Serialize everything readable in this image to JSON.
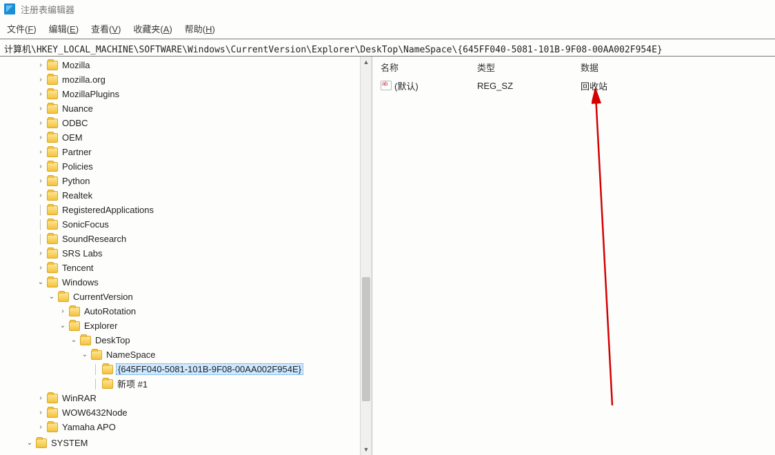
{
  "window": {
    "title": "注册表编辑器"
  },
  "menu": {
    "file": {
      "label": "文件",
      "accel": "F"
    },
    "edit": {
      "label": "编辑",
      "accel": "E"
    },
    "view": {
      "label": "查看",
      "accel": "V"
    },
    "fav": {
      "label": "收藏夹",
      "accel": "A"
    },
    "help": {
      "label": "帮助",
      "accel": "H"
    }
  },
  "addressbar": {
    "path": "计算机\\HKEY_LOCAL_MACHINE\\SOFTWARE\\Windows\\CurrentVersion\\Explorer\\DeskTop\\NameSpace\\{645FF040-5081-101B-9F08-00AA002F954E}"
  },
  "tree": {
    "items": [
      {
        "depth": 3,
        "expander": ">",
        "label": "Mozilla"
      },
      {
        "depth": 3,
        "expander": ">",
        "label": "mozilla.org"
      },
      {
        "depth": 3,
        "expander": ">",
        "label": "MozillaPlugins"
      },
      {
        "depth": 3,
        "expander": ">",
        "label": "Nuance"
      },
      {
        "depth": 3,
        "expander": ">",
        "label": "ODBC"
      },
      {
        "depth": 3,
        "expander": ">",
        "label": "OEM"
      },
      {
        "depth": 3,
        "expander": ">",
        "label": "Partner"
      },
      {
        "depth": 3,
        "expander": ">",
        "label": "Policies"
      },
      {
        "depth": 3,
        "expander": ">",
        "label": "Python"
      },
      {
        "depth": 3,
        "expander": ">",
        "label": "Realtek"
      },
      {
        "depth": 3,
        "expander": "",
        "label": "RegisteredApplications",
        "leaf": true
      },
      {
        "depth": 3,
        "expander": "",
        "label": "SonicFocus",
        "leaf": true
      },
      {
        "depth": 3,
        "expander": "",
        "label": "SoundResearch",
        "leaf": true
      },
      {
        "depth": 3,
        "expander": ">",
        "label": "SRS Labs"
      },
      {
        "depth": 3,
        "expander": ">",
        "label": "Tencent"
      },
      {
        "depth": 3,
        "expander": "v",
        "label": "Windows"
      },
      {
        "depth": 4,
        "expander": "v",
        "label": "CurrentVersion"
      },
      {
        "depth": 5,
        "expander": ">",
        "label": "AutoRotation"
      },
      {
        "depth": 5,
        "expander": "v",
        "label": "Explorer"
      },
      {
        "depth": 6,
        "expander": "v",
        "label": "DeskTop"
      },
      {
        "depth": 7,
        "expander": "v",
        "label": "NameSpace"
      },
      {
        "depth": 8,
        "expander": "",
        "label": "{645FF040-5081-101B-9F08-00AA002F954E}",
        "selected": true,
        "leaf": true
      },
      {
        "depth": 8,
        "expander": "",
        "label": "新项 #1",
        "leaf": true
      },
      {
        "depth": 3,
        "expander": ">",
        "label": "WinRAR"
      },
      {
        "depth": 3,
        "expander": ">",
        "label": "WOW6432Node"
      },
      {
        "depth": 3,
        "expander": ">",
        "label": "Yamaha APO"
      },
      {
        "depth": 2,
        "expander": "v",
        "label": "SYSTEM",
        "cutoff": true
      }
    ]
  },
  "values": {
    "headers": {
      "name": "名称",
      "type": "类型",
      "data": "数据"
    },
    "rows": [
      {
        "name": "(默认)",
        "type": "REG_SZ",
        "data": "回收站"
      }
    ]
  }
}
